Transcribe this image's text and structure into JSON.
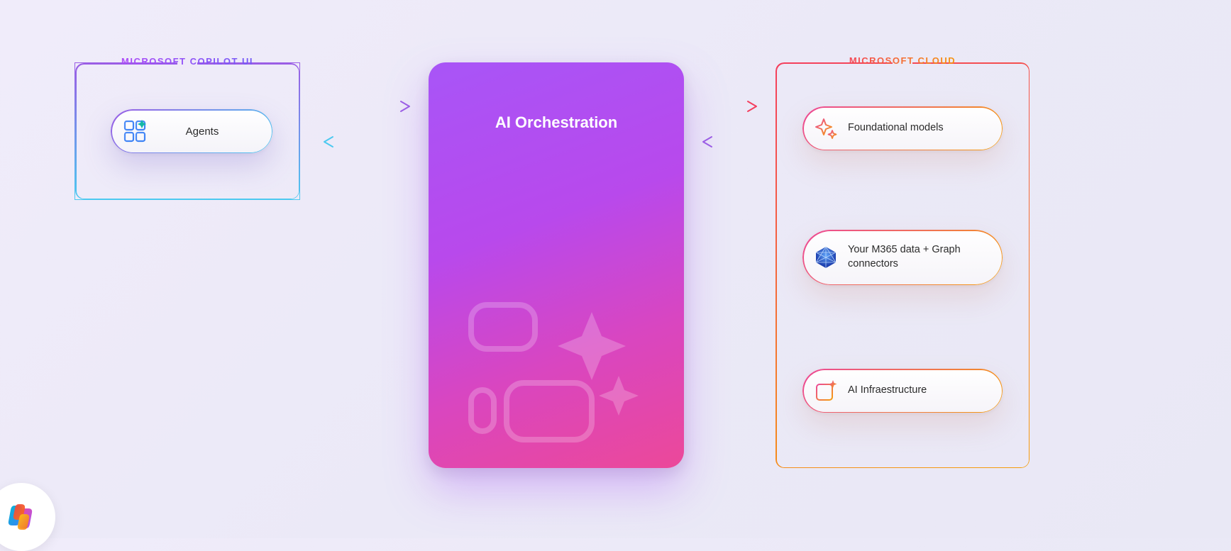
{
  "left": {
    "title": "MICROSOFT COPILOT UI",
    "pill": {
      "label": "Agents"
    }
  },
  "center": {
    "title": "AI Orchestration"
  },
  "right": {
    "title": "MICROSOFT CLOUD",
    "pills": [
      {
        "label": "Foundational models"
      },
      {
        "label": "Your M365 data + Graph connectors"
      },
      {
        "label": "AI Infraestructure"
      }
    ]
  }
}
